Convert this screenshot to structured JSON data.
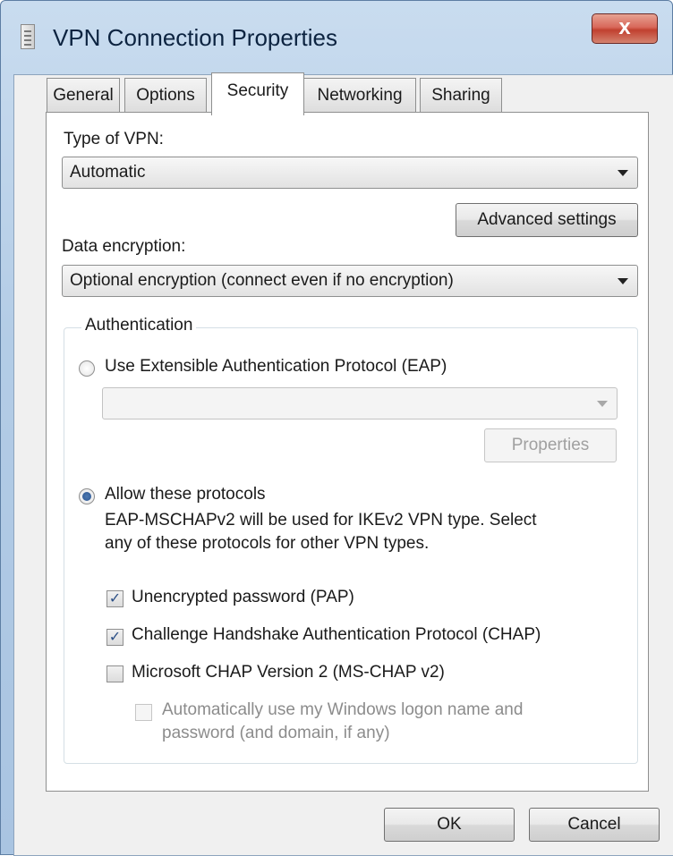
{
  "window": {
    "title": "VPN Connection Properties",
    "close_label": "x"
  },
  "tabs": [
    {
      "label": "General",
      "active": false
    },
    {
      "label": "Options",
      "active": false
    },
    {
      "label": "Security",
      "active": true
    },
    {
      "label": "Networking",
      "active": false
    },
    {
      "label": "Sharing",
      "active": false
    }
  ],
  "security": {
    "vpn_type_label": "Type of VPN:",
    "vpn_type_value": "Automatic",
    "advanced_settings_label": "Advanced settings",
    "encryption_label": "Data encryption:",
    "encryption_value": "Optional encryption (connect even if no encryption)",
    "authentication": {
      "group_label": "Authentication",
      "eap_radio_label": "Use Extensible Authentication Protocol (EAP)",
      "eap_selected": false,
      "eap_method_value": "",
      "properties_label": "Properties",
      "allow_radio_label": "Allow these protocols",
      "allow_selected": true,
      "note_line1": "EAP-MSCHAPv2 will be used for IKEv2 VPN type. Select",
      "note_line2": "any of these protocols for other VPN types.",
      "protocols": [
        {
          "label": "Unencrypted password (PAP)",
          "checked": true
        },
        {
          "label": "Challenge Handshake Authentication Protocol (CHAP)",
          "checked": true
        },
        {
          "label": "Microsoft CHAP Version 2 (MS-CHAP v2)",
          "checked": false
        }
      ],
      "auto_logon_line1": "Automatically use my Windows logon name and",
      "auto_logon_line2": "password (and domain, if any)",
      "auto_logon_checked": false,
      "auto_logon_enabled": false
    }
  },
  "footer": {
    "ok_label": "OK",
    "cancel_label": "Cancel"
  }
}
